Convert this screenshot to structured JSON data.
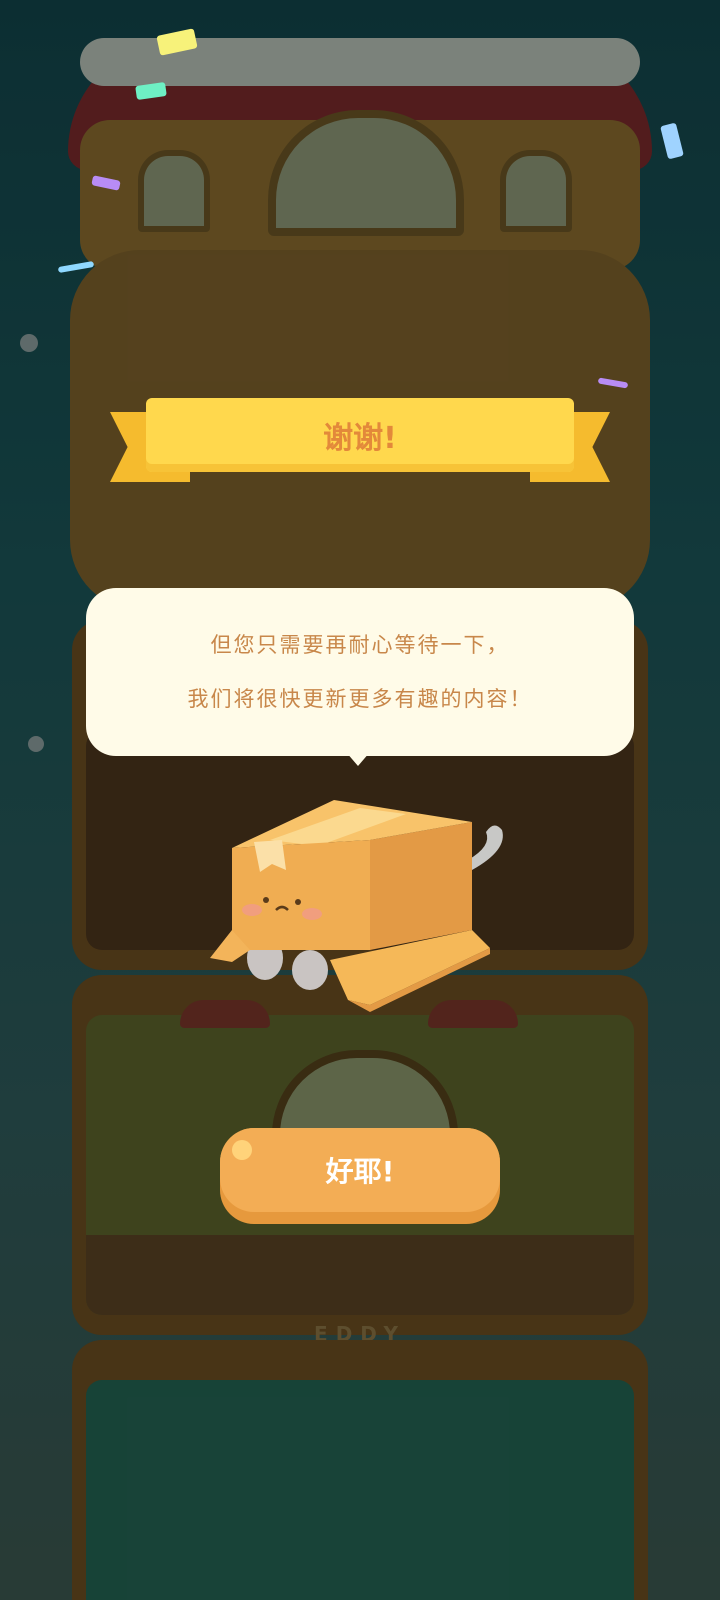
{
  "dialog": {
    "title": "谢谢!",
    "message_line1": "但您只需要再耐心等待一下，",
    "message_line2": "我们将很快更新更多有趣的内容！",
    "confirm_label": "好耶!"
  },
  "background": {
    "floor_sign": "EDDY"
  },
  "colors": {
    "ribbon": "#ffd84d",
    "title_text": "#e3893a",
    "bubble": "#fffbe8",
    "message_text": "#c8874a",
    "button": "#f3ad55"
  }
}
